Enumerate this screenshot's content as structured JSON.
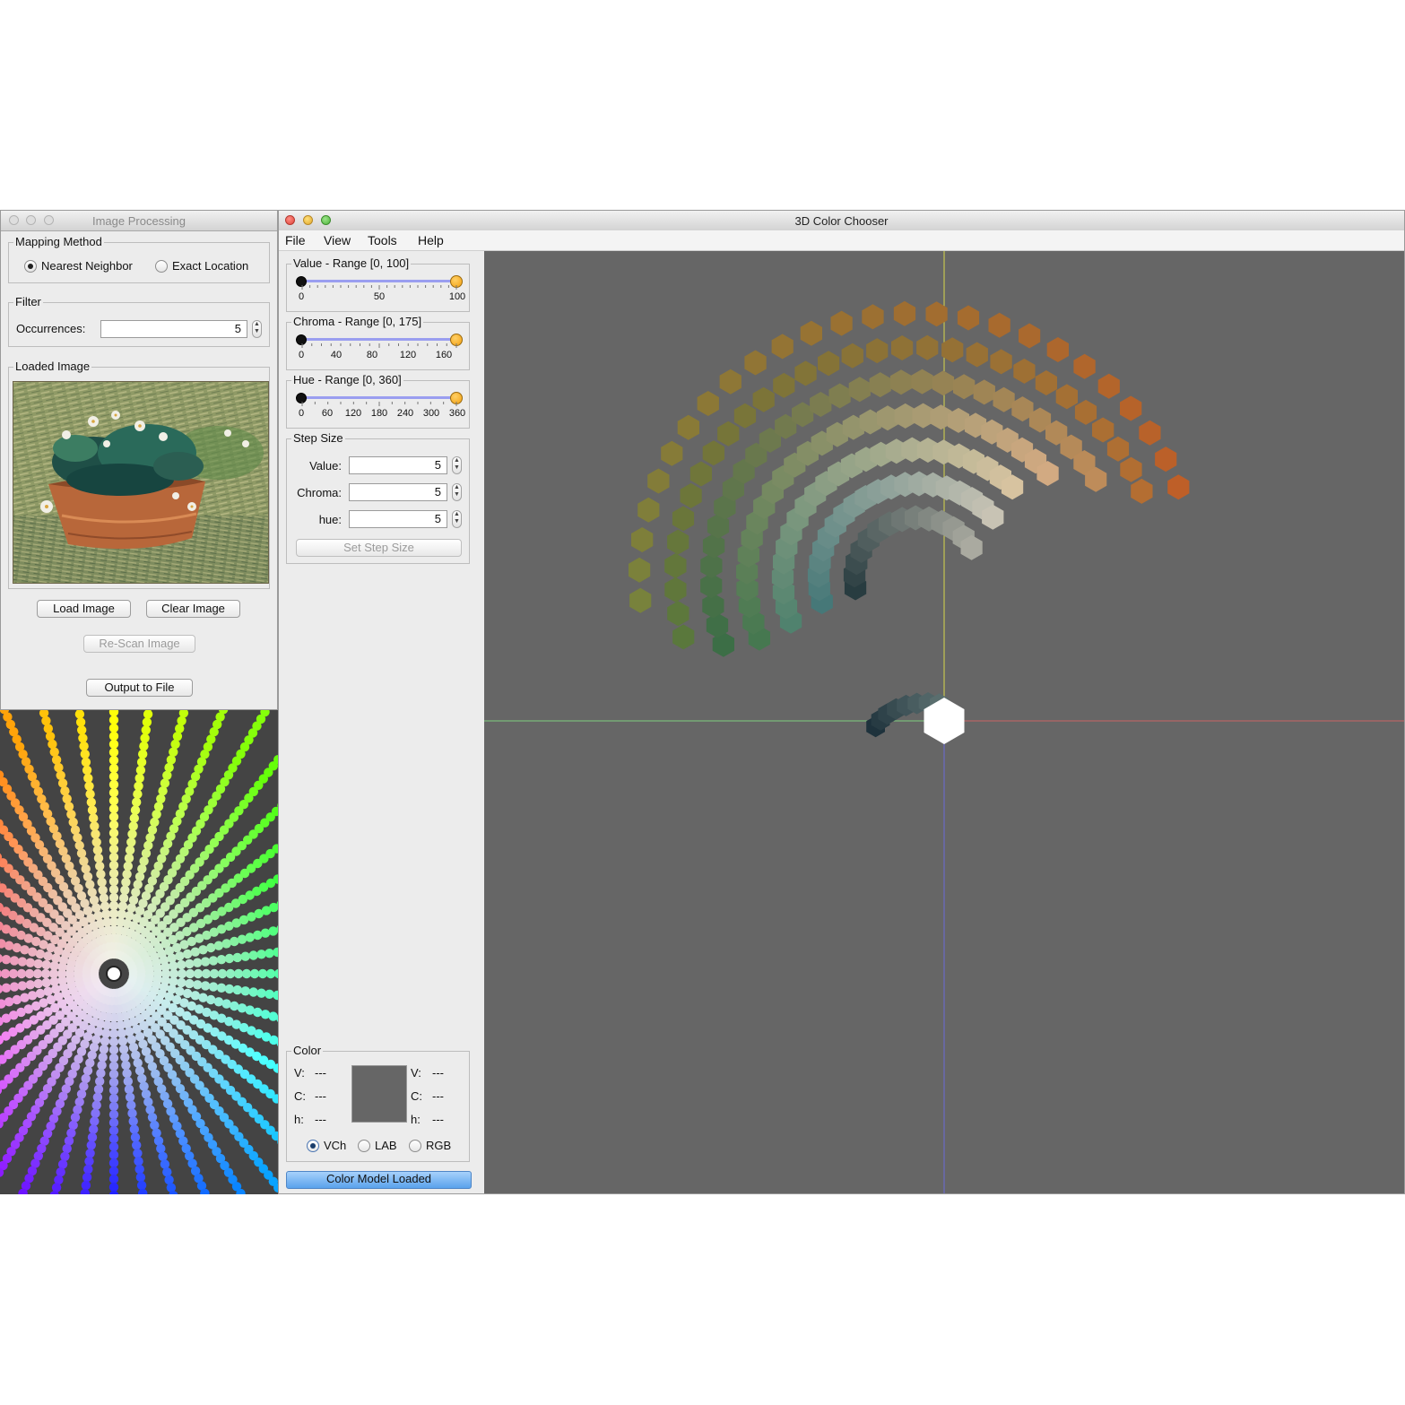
{
  "image_processing": {
    "title": "Image Processing",
    "mapping_method": {
      "title": "Mapping Method",
      "options": [
        "Nearest Neighbor",
        "Exact Location"
      ],
      "selected": "Nearest Neighbor"
    },
    "filter": {
      "title": "Filter",
      "occurrences_label": "Occurrences:",
      "occurrences_value": "5"
    },
    "loaded_image": {
      "title": "Loaded Image"
    },
    "buttons": {
      "load": "Load Image",
      "clear": "Clear Image",
      "rescan": "Re-Scan Image",
      "output": "Output to File"
    }
  },
  "color_chooser": {
    "title": "3D Color Chooser",
    "menu": [
      "File",
      "View",
      "Tools",
      "Help"
    ],
    "value_range": {
      "title": "Value - Range [0, 100]",
      "ticks": [
        "0",
        "50",
        "100"
      ]
    },
    "chroma_range": {
      "title": "Chroma - Range [0, 175]",
      "ticks": [
        "0",
        "40",
        "80",
        "120",
        "160"
      ]
    },
    "hue_range": {
      "title": "Hue - Range [0, 360]",
      "ticks": [
        "0",
        "60",
        "120",
        "180",
        "240",
        "300",
        "360"
      ]
    },
    "step_size": {
      "title": "Step Size",
      "value_label": "Value:",
      "value": "5",
      "chroma_label": "Chroma:",
      "chroma": "5",
      "hue_label": "hue:",
      "hue": "5",
      "button": "Set Step Size"
    },
    "color": {
      "title": "Color",
      "left": {
        "v_label": "V:",
        "v": "---",
        "c_label": "C:",
        "c": "---",
        "h_label": "h:",
        "h": "---"
      },
      "right": {
        "v_label": "V:",
        "v": "---",
        "c_label": "C:",
        "c": "---",
        "h_label": "h:",
        "h": "---"
      },
      "swatch": "#666666",
      "modes": [
        "VCh",
        "LAB",
        "RGB"
      ],
      "selected_mode": "VCh"
    },
    "status": "Color Model Loaded"
  },
  "colors": {
    "viewport_bg": "#666666",
    "axis_x": "#c86464",
    "axis_y": "#d8d84a",
    "axis_z": "#6a6ad8",
    "axis_green": "#7fcf7f",
    "wheel_bg": "#444444"
  }
}
